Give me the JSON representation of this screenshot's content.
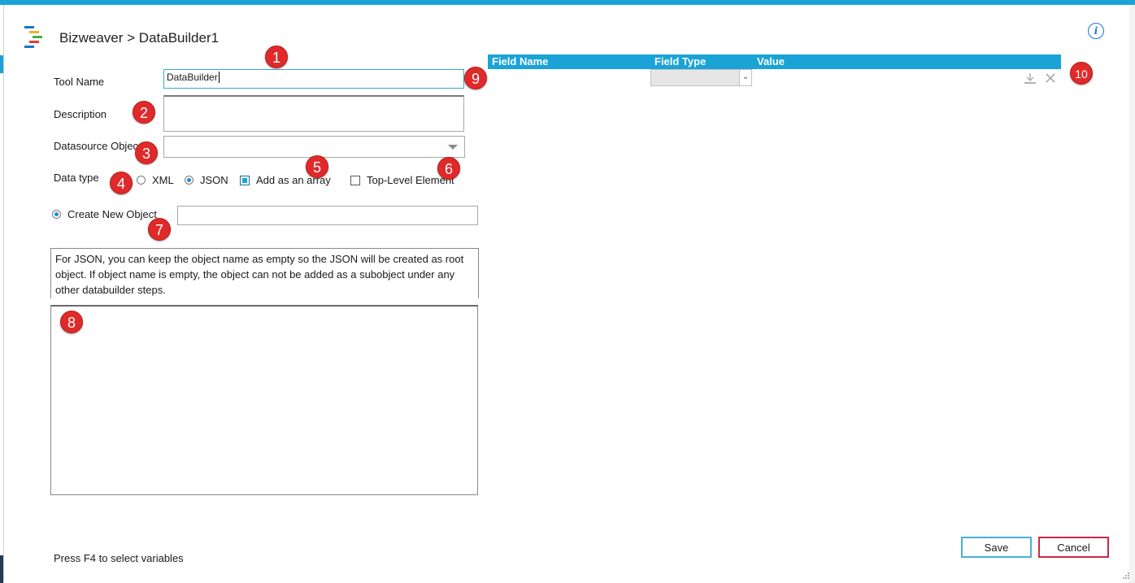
{
  "header": {
    "title": "Bizweaver > DataBuilder1",
    "logo_colors": [
      "#1a74d6",
      "#f2b01e",
      "#3db24a",
      "#e83a3a",
      "#1a74d6"
    ],
    "info_icon": "info-icon"
  },
  "form": {
    "tool_name_label": "Tool Name",
    "tool_name_value": "DataBuilder",
    "description_label": "Description",
    "description_value": "",
    "datasource_label": "Datasource Objec",
    "datasource_value": "",
    "data_type_label": "Data type",
    "xml_label": "XML",
    "json_label": "JSON",
    "add_array_label": "Add as an array",
    "top_level_label": "Top-Level Element",
    "create_new_label": "Create New Object",
    "create_new_value": "",
    "data_type_selected": "JSON",
    "add_array_checked": true,
    "top_level_checked": false,
    "create_new_selected": true
  },
  "note": {
    "text": "For JSON, you can keep the object name as empty so the JSON will be created as root object.  If object name is empty, the object can not be added as a subobject under any other databuilder steps."
  },
  "grid": {
    "columns": [
      "Field Name",
      "Field Type",
      "Value"
    ],
    "header_color": "#1aa3d6",
    "row_icons": [
      "import-icon",
      "close-icon"
    ]
  },
  "callouts": [
    "1",
    "2",
    "3",
    "4",
    "5",
    "6",
    "7",
    "8",
    "9",
    "10"
  ],
  "footer": {
    "hint": "Press F4 to select variables",
    "save_label": "Save",
    "cancel_label": "Cancel"
  },
  "colors": {
    "accent": "#1aa3d6",
    "badge": "#e02a2a",
    "cancel_border": "#c72a4a",
    "save_border": "#4aaed8"
  }
}
